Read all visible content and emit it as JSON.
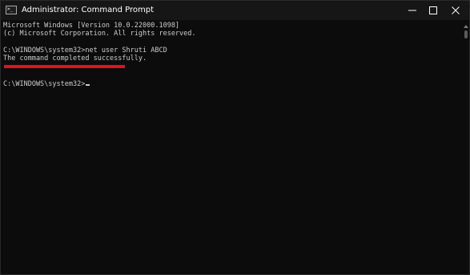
{
  "window": {
    "title": "Administrator: Command Prompt",
    "icon": "cmd-icon",
    "icon_glyph": ">_",
    "controls": [
      "minimize-icon",
      "maximize-icon",
      "close-icon"
    ]
  },
  "console": {
    "lines": [
      "Microsoft Windows [Version 10.0.22000.1098]",
      "(c) Microsoft Corporation. All rights reserved.",
      "C:\\WINDOWS\\system32>net user Shruti ABCD",
      "The command completed successfully."
    ],
    "prompt": "C:\\WINDOWS\\system32>",
    "highlight_color": "#e0121c",
    "text_color": "#cccccc",
    "background": "#0c0c0c"
  }
}
